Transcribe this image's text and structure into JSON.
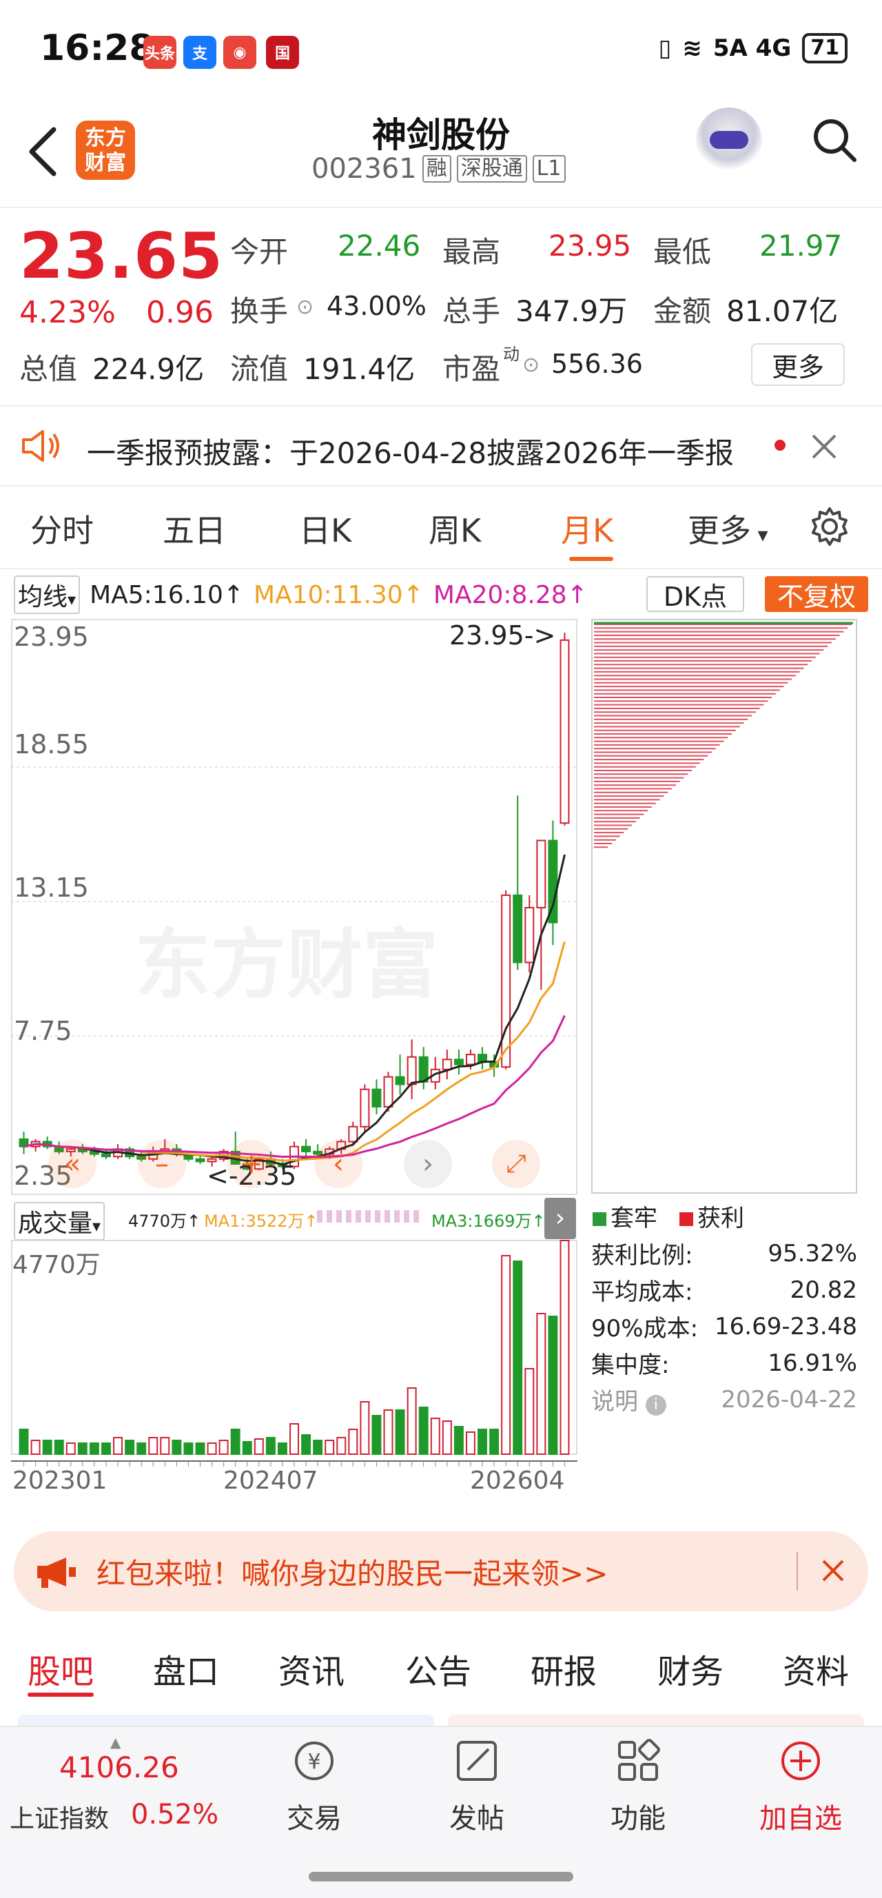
{
  "status_bar": {
    "time": "16:28",
    "apps": [
      {
        "label": "头条",
        "color": "#e8443a"
      },
      {
        "label": "支",
        "color": "#1677ff"
      },
      {
        "label": "◉",
        "color": "#e8443a"
      },
      {
        "label": "国",
        "color": "#c4161c"
      }
    ],
    "network": "5A 4G",
    "battery": "71"
  },
  "header": {
    "logo_text": "东方财富",
    "stock_name": "神剑股份",
    "stock_code": "002361",
    "tags": [
      "融",
      "深股通",
      "L1"
    ]
  },
  "quote": {
    "price": "23.65",
    "change_pct": "4.23%",
    "change_amt": "0.96",
    "fields": {
      "open_label": "今开",
      "open": "22.46",
      "high_label": "最高",
      "high": "23.95",
      "low_label": "最低",
      "low": "21.97",
      "turnover_label": "换手",
      "turnover": "43.00%",
      "volume_label": "总手",
      "volume": "347.9万",
      "amount_label": "金额",
      "amount": "81.07亿",
      "mktcap_label": "总值",
      "mktcap": "224.9亿",
      "float_label": "流值",
      "float": "191.4亿",
      "pe_label": "市盈",
      "pe_sup": "动",
      "pe": "556.36"
    },
    "more_label": "更多"
  },
  "notice": {
    "text": "一季报预披露：于2026-04-28披露2026年一季报"
  },
  "period_tabs": [
    "分时",
    "五日",
    "日K",
    "周K",
    "月K",
    "更多"
  ],
  "active_period": "月K",
  "ma_row": {
    "select": "均线",
    "ma5": "MA5:16.10↑",
    "ma10": "MA10:11.30↑",
    "ma20": "MA20:8.28↑",
    "dk": "DK点",
    "fuquan": "不复权",
    "colors": {
      "ma5": "#222222",
      "ma10": "#f0a020",
      "ma20": "#d020a0"
    }
  },
  "price_axis": [
    "23.95",
    "18.55",
    "13.15",
    "7.75",
    "2.35"
  ],
  "chart_annotations": {
    "high": "23.95->",
    "low": "<-2.35"
  },
  "watermark": "东方财富",
  "volume_row": {
    "select": "成交量",
    "vol": "4770万↑",
    "ma1": "MA1:3522万↑",
    "ma3": "MA3:1669万↑",
    "max": "4770万"
  },
  "date_axis": [
    "202301",
    "202407",
    "202604"
  ],
  "chart_data": {
    "type": "candlestick",
    "period": "monthly",
    "ylim": [
      2.35,
      23.95
    ],
    "candles": [
      [
        3.6,
        3.9,
        3.0,
        3.3
      ],
      [
        3.3,
        3.6,
        3.1,
        3.5
      ],
      [
        3.5,
        3.7,
        3.2,
        3.3
      ],
      [
        3.3,
        3.5,
        3.0,
        3.1
      ],
      [
        3.1,
        3.3,
        2.9,
        3.2
      ],
      [
        3.2,
        3.4,
        3.0,
        3.1
      ],
      [
        3.1,
        3.3,
        2.9,
        3.0
      ],
      [
        3.0,
        3.2,
        2.8,
        2.9
      ],
      [
        2.9,
        3.4,
        2.8,
        3.2
      ],
      [
        3.2,
        3.3,
        2.8,
        2.9
      ],
      [
        2.9,
        3.1,
        2.7,
        2.8
      ],
      [
        2.8,
        3.3,
        2.7,
        3.1
      ],
      [
        3.1,
        3.6,
        3.0,
        3.2
      ],
      [
        3.2,
        3.4,
        2.9,
        3.0
      ],
      [
        3.0,
        3.1,
        2.7,
        2.8
      ],
      [
        2.8,
        3.0,
        2.6,
        2.7
      ],
      [
        2.7,
        2.9,
        2.5,
        2.8
      ],
      [
        2.8,
        3.2,
        2.7,
        3.1
      ],
      [
        3.1,
        3.9,
        3.0,
        2.6
      ],
      [
        2.6,
        2.8,
        2.35,
        2.4
      ],
      [
        2.4,
        2.9,
        2.35,
        2.8
      ],
      [
        2.8,
        3.1,
        2.5,
        2.6
      ],
      [
        2.6,
        2.8,
        2.4,
        2.5
      ],
      [
        2.5,
        3.5,
        2.4,
        3.3
      ],
      [
        3.3,
        3.6,
        2.9,
        3.1
      ],
      [
        3.1,
        3.4,
        2.9,
        3.0
      ],
      [
        3.0,
        3.3,
        2.8,
        3.2
      ],
      [
        3.2,
        3.6,
        3.0,
        3.5
      ],
      [
        3.5,
        4.3,
        3.4,
        4.1
      ],
      [
        4.1,
        5.8,
        3.9,
        5.6
      ],
      [
        5.6,
        6.0,
        4.6,
        4.9
      ],
      [
        4.9,
        6.3,
        4.7,
        6.1
      ],
      [
        6.1,
        7.0,
        5.4,
        5.8
      ],
      [
        5.8,
        7.6,
        5.2,
        6.9
      ],
      [
        6.9,
        7.3,
        5.6,
        5.9
      ],
      [
        5.9,
        6.9,
        5.6,
        6.4
      ],
      [
        6.4,
        7.2,
        6.0,
        6.8
      ],
      [
        6.8,
        7.2,
        6.2,
        6.6
      ],
      [
        6.6,
        7.2,
        6.4,
        7.0
      ],
      [
        7.0,
        7.3,
        6.4,
        6.7
      ],
      [
        6.7,
        7.0,
        6.1,
        6.5
      ],
      [
        6.5,
        13.6,
        6.4,
        13.4
      ],
      [
        13.4,
        17.4,
        10.4,
        10.7
      ],
      [
        10.7,
        13.4,
        10.3,
        12.9
      ],
      [
        12.9,
        14.7,
        9.6,
        15.6
      ],
      [
        15.6,
        16.4,
        11.4,
        12.3
      ],
      [
        16.3,
        23.95,
        16.2,
        23.65
      ]
    ],
    "ma5_note": "MA5",
    "volume_max": 4770
  },
  "chip": {
    "legend_trapped": "套牢",
    "legend_profit": "获利",
    "rows": [
      {
        "label": "获利比例:",
        "value": "95.32%"
      },
      {
        "label": "平均成本:",
        "value": "20.82"
      },
      {
        "label": "90%成本:",
        "value": "16.69-23.48"
      },
      {
        "label": "集中度:",
        "value": "16.91%"
      }
    ],
    "note_label": "说明",
    "date": "2026-04-22"
  },
  "banner": {
    "text": "红包来啦！喊你身边的股民一起来领>>"
  },
  "bottom_tabs": [
    "股吧",
    "盘口",
    "资讯",
    "公告",
    "研报",
    "财务",
    "资料"
  ],
  "footer": {
    "index_value": "4106.26",
    "index_name": "上证指数",
    "index_change": "0.52%",
    "buttons": [
      "交易",
      "发帖",
      "功能",
      "加自选"
    ]
  }
}
